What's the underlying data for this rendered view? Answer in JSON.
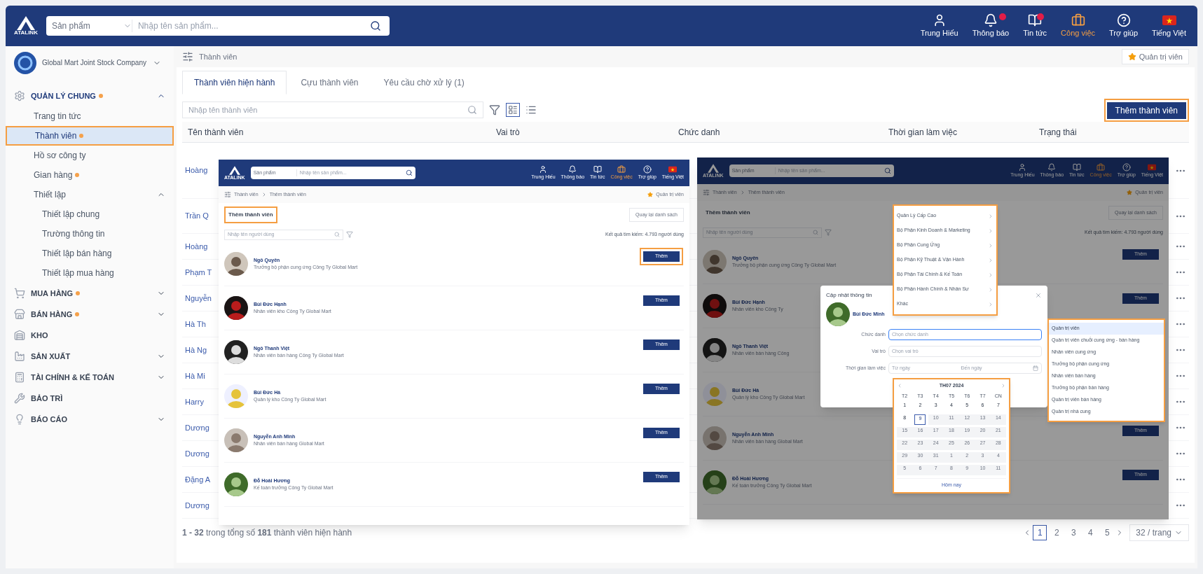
{
  "top_bar": {
    "logo": "ATALINK",
    "search_category": "Sản phẩm",
    "search_placeholder": "Nhập tên sản phẩm...",
    "actions": [
      {
        "kind": "user",
        "label": "Trung Hiếu",
        "dot": false,
        "selected": false
      },
      {
        "kind": "bell",
        "label": "Thông báo",
        "dot": true,
        "selected": false
      },
      {
        "kind": "news",
        "label": "Tin tức",
        "dot": true,
        "selected": false
      },
      {
        "kind": "work",
        "label": "Công việc",
        "dot": false,
        "selected": true
      },
      {
        "kind": "help",
        "label": "Trợ giúp",
        "dot": false,
        "selected": false
      },
      {
        "kind": "flag",
        "label": "Tiếng Việt",
        "dot": false,
        "selected": false
      }
    ]
  },
  "company": {
    "name": "Global Mart Joint Stock Company"
  },
  "sidebar": {
    "items": [
      {
        "kind": "group",
        "label": "QUẢN LÝ CHUNG",
        "dot": true,
        "expanded": true,
        "children": [
          {
            "kind": "link",
            "label": "Trang tin tức",
            "dot": false,
            "selected": false
          },
          {
            "kind": "link",
            "label": "Thành viên",
            "dot": true,
            "selected": true
          },
          {
            "kind": "link",
            "label": "Hồ sơ công ty",
            "dot": false,
            "selected": false
          },
          {
            "kind": "link",
            "label": "Gian hàng",
            "dot": true,
            "selected": false
          },
          {
            "kind": "group",
            "label": "Thiết lập",
            "dot": false,
            "expanded": true,
            "selected": false,
            "children": [
              {
                "label": "Thiết lập chung",
                "dot": false,
                "selected": false
              },
              {
                "label": "Trường thông tin",
                "dot": false,
                "selected": false
              },
              {
                "label": "Thiết lập bán hàng",
                "dot": false,
                "selected": false
              },
              {
                "label": "Thiết lập mua hàng",
                "dot": false,
                "selected": false
              }
            ]
          }
        ]
      },
      {
        "kind": "group",
        "label": "MUA HÀNG",
        "dot": true,
        "expanded": false
      },
      {
        "kind": "group",
        "label": "BÁN HÀNG",
        "dot": true,
        "expanded": false
      },
      {
        "kind": "link",
        "label": "KHO",
        "dot": false
      },
      {
        "kind": "group",
        "label": "SẢN XUẤT",
        "dot": false,
        "expanded": false
      },
      {
        "kind": "group",
        "label": "TÀI CHÍNH & KẾ TOÁN",
        "dot": false,
        "expanded": false
      },
      {
        "kind": "link",
        "label": "BẢO TRÌ",
        "dot": false
      },
      {
        "kind": "group",
        "label": "BÁO CÁO",
        "dot": false,
        "expanded": false
      }
    ]
  },
  "breadcrumb": "Thành viên",
  "role_badge": "Quản trị viên",
  "tabs": [
    {
      "label": "Thành viên hiện hành",
      "selected": true
    },
    {
      "label": "Cựu thành viên",
      "selected": false
    },
    {
      "label": "Yêu cầu chờ xử lý (1)",
      "selected": false
    }
  ],
  "search": {
    "placeholder": "Nhập tên thành viên"
  },
  "add_button": "Thêm thành viên",
  "table": {
    "columns": [
      "Tên thành viên",
      "Vai trò",
      "Chức danh",
      "Thời gian làm việc",
      "Trạng thái"
    ],
    "rows": [
      {
        "name": "Hoàng"
      },
      {
        "name": "Trần Q"
      },
      {
        "name": "Hoàng"
      },
      {
        "name": "Phạm T"
      },
      {
        "name": "Nguyễn"
      },
      {
        "name": "Hà Th"
      },
      {
        "name": "Hà Ng"
      },
      {
        "name": "Hà Mi"
      },
      {
        "name": "Harry"
      },
      {
        "name": "Dương"
      },
      {
        "name": "Dương"
      },
      {
        "name": "Đặng A"
      },
      {
        "name": "Dương"
      }
    ]
  },
  "footer": {
    "summary": "**1 - 32** trong tổng số **181** thành viên hiện hành",
    "pages": [
      {
        "label": "1",
        "selected": true
      },
      {
        "label": "2",
        "selected": false
      },
      {
        "label": "3",
        "selected": false
      },
      {
        "label": "4",
        "selected": false
      },
      {
        "label": "5",
        "selected": false
      }
    ],
    "page_size": "32 / trang"
  },
  "embedded_screens": [
    {
      "dimmed": false,
      "top_bar": {
        "logo": "ATALINK",
        "search_category": "Sản phẩm",
        "search_placeholder": "Nhập tên sản phẩm...",
        "labels": [
          "Trung Hiếu",
          "Thông báo",
          "Tin tức",
          "Công việc",
          "Trợ giúp",
          "Tiếng Việt"
        ]
      },
      "breadcrumb": [
        "Thành viên",
        "Thêm thành viên"
      ],
      "role_badge": "Quản trị viên",
      "title": "Thêm thành viên",
      "title_highlighted": true,
      "back_button": "Quay lại danh sách",
      "search_placeholder": "Nhập tên người dùng",
      "result": "Kết quả tìm kiếm: 4.793 người dùng",
      "members": [
        {
          "name": "Ngô Quyên",
          "subtitle": "Trưởng bộ phận cung ứng Công Ty Global Mart",
          "button": "Thêm",
          "highlighted": true
        },
        {
          "name": "Bùi Đức Hạnh",
          "subtitle": "Nhân viên kho Công Ty Global Mart",
          "button": "Thêm",
          "highlighted": false
        },
        {
          "name": "Ngô Thanh Việt",
          "subtitle": "Nhân viên bán hàng Công Ty Global Mart",
          "button": "Thêm",
          "highlighted": false
        },
        {
          "name": "Bùi Đức Hà",
          "subtitle": "Quản lý kho Công Ty Global Mart",
          "button": "Thêm",
          "highlighted": false
        },
        {
          "name": "Nguyễn Anh Minh",
          "subtitle": "Nhân viên bán hàng Global Mart",
          "button": "Thêm",
          "highlighted": false
        },
        {
          "name": "Đỗ Hoài Hương",
          "subtitle": "Kế toán trưởng Công Ty Global Mart",
          "button": "Thêm",
          "highlighted": false
        }
      ]
    },
    {
      "dimmed": true,
      "top_bar": {
        "logo": "ATALINK",
        "search_category": "Sản phẩm",
        "search_placeholder": "Nhập tên sản phẩm...",
        "labels": [
          "Trung Hiếu",
          "Thông báo",
          "Tin tức",
          "Công việc",
          "Trợ giúp",
          "Tiếng Việt"
        ]
      },
      "breadcrumb": [
        "Thành viên",
        "Thêm thành viên"
      ],
      "role_badge": "Quản trị viên",
      "title": "Thêm thành viên",
      "title_highlighted": false,
      "back_button": "Quay lại danh sách",
      "search_placeholder": "Nhập tên người dùng",
      "result": "Kết quả tìm kiếm: 4.793 người dùng",
      "members": [
        {
          "name": "Ngô Quyên",
          "subtitle": "Trưởng bộ phận cung ứng Công Ty Global Mart",
          "button": "Thêm",
          "highlighted": false
        },
        {
          "name": "Bùi Đức Hạnh",
          "subtitle": "Nhân viên kho Công Ty",
          "button": "Thêm",
          "highlighted": false
        },
        {
          "name": "Ngô Thanh Việt",
          "subtitle": "Nhân viên bán hàng Công"
        },
        {
          "name": "Bùi Đức Hà",
          "subtitle": "Quản lý kho Công Ty Global Mart"
        },
        {
          "name": "Nguyễn Anh Minh",
          "subtitle": "Nhân viên bán hàng Global Mart",
          "button": "Thêm",
          "highlighted": false
        },
        {
          "name": "Đỗ Hoài Hương",
          "subtitle": "Kế toán trưởng Công Ty Global Mart",
          "button": "Thêm",
          "highlighted": false
        }
      ],
      "modal": {
        "title": "Cập nhật thông tin",
        "user": "Bùi Đức Minh",
        "fields": [
          {
            "label": "Chức danh",
            "placeholder": "Chọn chức danh"
          },
          {
            "label": "Vai trò",
            "placeholder": "Chọn vai trò"
          },
          {
            "label": "Thời gian làm việc",
            "placeholder": "Từ ngày",
            "placeholder_end": "Đến ngày"
          }
        ],
        "title_menu": [
          "Quản Lý Cấp Cao",
          "Bộ Phận Kinh Doanh & Marketing",
          "Bộ Phận Cung Ứng",
          "Bộ Phận Kỹ Thuật & Vận Hành",
          "Bộ Phận Tài Chính & Kế Toán",
          "Bộ Phận Hành Chính & Nhân Sự",
          "Khác"
        ],
        "role_menu": [
          {
            "label": "Quản trị viên",
            "selected": true
          },
          {
            "label": "Quản trị viên chuỗi cung ứng - bán hàng",
            "selected": false
          },
          {
            "label": "Nhân viên cung ứng",
            "selected": false
          },
          {
            "label": "Trưởng bộ phận cung ứng",
            "selected": false
          },
          {
            "label": "Nhân viên bán hàng",
            "selected": false
          },
          {
            "label": "Trưởng bộ phận bán hàng",
            "selected": false
          },
          {
            "label": "Quản trị viên bán hàng",
            "selected": false
          },
          {
            "label": "Quản trị nhà cung",
            "selected": false
          }
        ],
        "calendar": {
          "month": "TH07 2024",
          "weekdays": [
            "T2",
            "T3",
            "T4",
            "T5",
            "T6",
            "T7",
            "CN"
          ],
          "today_button": "Hôm nay",
          "days": [
            {
              "label": "1",
              "selected": false,
              "disabled": false
            },
            {
              "label": "2",
              "selected": false,
              "disabled": false
            },
            {
              "label": "3",
              "selected": false,
              "disabled": false
            },
            {
              "label": "4",
              "selected": false,
              "disabled": false
            },
            {
              "label": "5",
              "selected": false,
              "disabled": false
            },
            {
              "label": "6",
              "selected": false,
              "disabled": false
            },
            {
              "label": "7",
              "selected": false,
              "disabled": false
            },
            {
              "label": "8",
              "selected": false,
              "disabled": false
            },
            {
              "label": "9",
              "selected": true,
              "disabled": false
            },
            {
              "label": "10",
              "selected": false,
              "disabled": true
            },
            {
              "label": "11",
              "selected": false,
              "disabled": true
            },
            {
              "label": "12",
              "selected": false,
              "disabled": true
            },
            {
              "label": "13",
              "selected": false,
              "disabled": true
            },
            {
              "label": "14",
              "selected": false,
              "disabled": true
            },
            {
              "label": "15",
              "selected": false,
              "disabled": true
            },
            {
              "label": "16",
              "selected": false,
              "disabled": true
            },
            {
              "label": "17",
              "selected": false,
              "disabled": true
            },
            {
              "label": "18",
              "selected": false,
              "disabled": true
            },
            {
              "label": "19",
              "selected": false,
              "disabled": true
            },
            {
              "label": "20",
              "selected": false,
              "disabled": true
            },
            {
              "label": "21",
              "selected": false,
              "disabled": true
            },
            {
              "label": "22",
              "selected": false,
              "disabled": true
            },
            {
              "label": "23",
              "selected": false,
              "disabled": true
            },
            {
              "label": "24",
              "selected": false,
              "disabled": true
            },
            {
              "label": "25",
              "selected": false,
              "disabled": true
            },
            {
              "label": "26",
              "selected": false,
              "disabled": true
            },
            {
              "label": "27",
              "selected": false,
              "disabled": true
            },
            {
              "label": "28",
              "selected": false,
              "disabled": true
            },
            {
              "label": "29",
              "selected": false,
              "disabled": true
            },
            {
              "label": "30",
              "selected": false,
              "disabled": true
            },
            {
              "label": "31",
              "selected": false,
              "disabled": true
            },
            {
              "label": "1",
              "selected": false,
              "disabled": true
            },
            {
              "label": "2",
              "selected": false,
              "disabled": true
            },
            {
              "label": "3",
              "selected": false,
              "disabled": true
            },
            {
              "label": "4",
              "selected": false,
              "disabled": true
            },
            {
              "label": "5",
              "selected": false,
              "disabled": true
            },
            {
              "label": "6",
              "selected": false,
              "disabled": true
            },
            {
              "label": "7",
              "selected": false,
              "disabled": true
            },
            {
              "label": "8",
              "selected": false,
              "disabled": true
            },
            {
              "label": "9",
              "selected": false,
              "disabled": true
            },
            {
              "label": "10",
              "selected": false,
              "disabled": true
            },
            {
              "label": "11",
              "selected": false,
              "disabled": true
            }
          ]
        }
      }
    }
  ]
}
